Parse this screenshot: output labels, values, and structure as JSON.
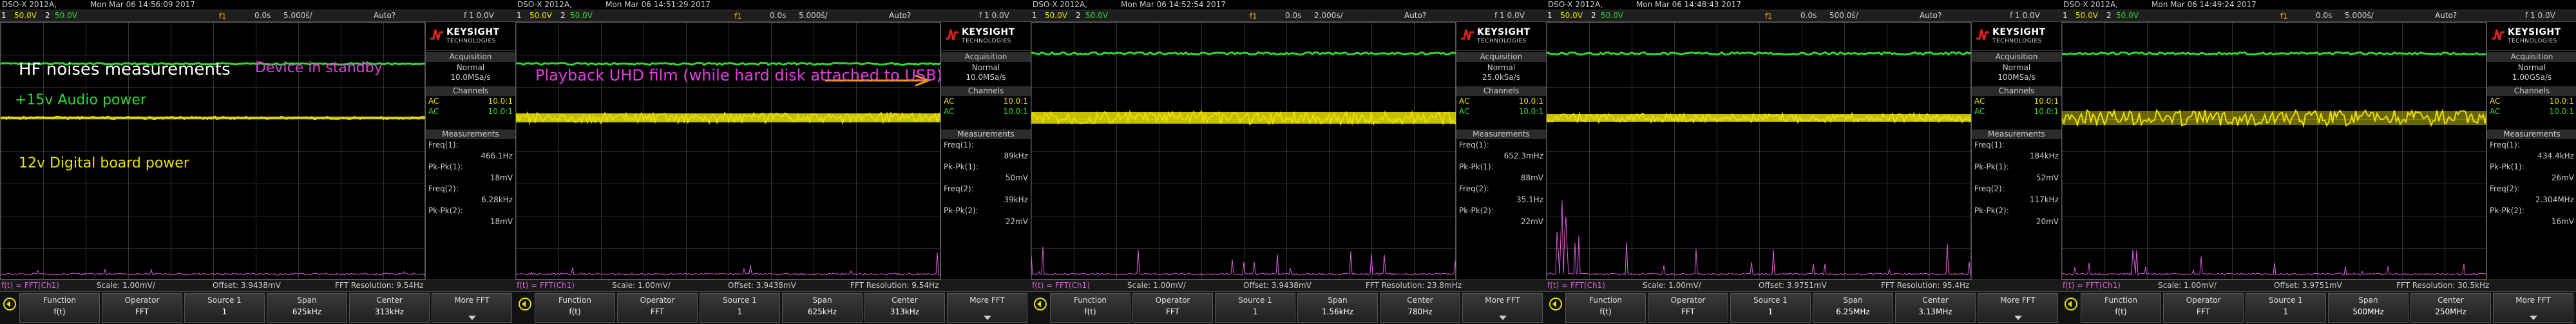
{
  "screens": [
    {
      "model": "DSO-X 2012A,",
      "datetime": "Mon Mar 06 14:56:09 2017",
      "status": {
        "ch1": "1",
        "ch1_scale": "50.0V",
        "ch2": "2",
        "ch2_scale": "50.0V",
        "trig": "f",
        "trig_level": "1",
        "offset": "0.0s",
        "timebase": "5.000ŝ/",
        "mode": "Auto?",
        "run": "f 1 0.0V"
      },
      "annotations": [
        {
          "text": "HF noises measurements",
          "color": "#ffffff"
        },
        {
          "text": "Device in standby",
          "color": "#e040e0"
        },
        {
          "text": "+15v Audio power",
          "color": "#2fd82f"
        },
        {
          "text": "12v Digital board power",
          "color": "#e8e000"
        }
      ],
      "panel": {
        "acq_mode": "Normal",
        "acq_rate": "10.0MSa/s",
        "channels": [
          {
            "coupling": "AC",
            "value": "10.0:1"
          },
          {
            "coupling": "AC",
            "value": "10.0:1"
          }
        ],
        "measurements": [
          {
            "label": "Freq(1):",
            "value": "466.1Hz"
          },
          {
            "label": "Pk-Pk(1):",
            "value": "18mV"
          },
          {
            "label": "Freq(2):",
            "value": "6.28kHz"
          },
          {
            "label": "Pk-Pk(2):",
            "value": "18mV"
          }
        ]
      },
      "fft": {
        "channel": "f(t) = FFT(Ch1)",
        "scale": "Scale: 1.00mV/",
        "offset": "Offset: 3.9438mV",
        "resolution": "FFT Resolution: 9.54Hz"
      },
      "softkeys": [
        {
          "l1": "Function",
          "l2": "f(t)"
        },
        {
          "l1": "Operator",
          "l2": "FFT"
        },
        {
          "l1": "Source 1",
          "l2": "1"
        },
        {
          "l1": "Span",
          "l2": "625kHz"
        },
        {
          "l1": "Center",
          "l2": "313kHz"
        },
        {
          "l1": "More FFT",
          "l2": ""
        }
      ],
      "traces": {
        "green_y": 0.16,
        "yellow_y": 0.37,
        "yellow_band": 0.01,
        "noise": 0.2
      }
    },
    {
      "model": "DSO-X 2012A,",
      "datetime": "Mon Mar 06 14:51:29 2017",
      "status": {
        "ch1": "1",
        "ch1_scale": "50.0V",
        "ch2": "2",
        "ch2_scale": "50.0V",
        "trig": "f",
        "trig_level": "1",
        "offset": "0.0s",
        "timebase": "5.000ŝ/",
        "mode": "Auto?",
        "run": "f 1 0.0V"
      },
      "annotations": [
        {
          "text": "Playback UHD film (while hard disk attached to USB)",
          "color": "#e040e0"
        }
      ],
      "panel": {
        "acq_mode": "Normal",
        "acq_rate": "10.0MSa/s",
        "channels": [
          {
            "coupling": "AC",
            "value": "10.0:1"
          },
          {
            "coupling": "AC",
            "value": "10.0:1"
          }
        ],
        "measurements": [
          {
            "label": "Freq(1):",
            "value": "89kHz"
          },
          {
            "label": "Pk-Pk(1):",
            "value": "50mV"
          },
          {
            "label": "Freq(2):",
            "value": "39kHz"
          },
          {
            "label": "Pk-Pk(2):",
            "value": "22mV"
          }
        ]
      },
      "fft": {
        "channel": "f(t) = FFT(Ch1)",
        "scale": "Scale: 1.00mV/",
        "offset": "Offset: 3.9438mV",
        "resolution": "FFT Resolution: 9.54Hz"
      },
      "softkeys": [
        {
          "l1": "Function",
          "l2": "f(t)"
        },
        {
          "l1": "Operator",
          "l2": "FFT"
        },
        {
          "l1": "Source 1",
          "l2": "1"
        },
        {
          "l1": "Span",
          "l2": "625kHz"
        },
        {
          "l1": "Center",
          "l2": "313kHz"
        },
        {
          "l1": "More FFT",
          "l2": ""
        }
      ],
      "traces": {
        "green_y": 0.16,
        "yellow_y": 0.37,
        "yellow_band": 0.035,
        "noise": 0.6
      }
    },
    {
      "model": "DSO-X 2012A,",
      "datetime": "Mon Mar 06 14:52:54 2017",
      "status": {
        "ch1": "1",
        "ch1_scale": "50.0V",
        "ch2": "2",
        "ch2_scale": "50.0V",
        "trig": "f",
        "trig_level": "1",
        "offset": "0.0s",
        "timebase": "2.000s/",
        "mode": "Auto?",
        "run": "f 1 0.0V"
      },
      "annotations": [],
      "panel": {
        "acq_mode": "Normal",
        "acq_rate": "25.0kSa/s",
        "channels": [
          {
            "coupling": "AC",
            "value": "10.0:1"
          },
          {
            "coupling": "AC",
            "value": "10.0:1"
          }
        ],
        "measurements": [
          {
            "label": "Freq(1):",
            "value": "652.3mHz"
          },
          {
            "label": "Pk-Pk(1):",
            "value": "88mV"
          },
          {
            "label": "Freq(2):",
            "value": "35.1Hz"
          },
          {
            "label": "Pk-Pk(2):",
            "value": "22mV"
          }
        ]
      },
      "fft": {
        "channel": "f(t) = FFT(Ch1)",
        "scale": "Scale: 1.00mV/",
        "offset": "Offset: 3.9438mV",
        "resolution": "FFT Resolution: 23.8mHz"
      },
      "softkeys": [
        {
          "l1": "Function",
          "l2": "f(t)"
        },
        {
          "l1": "Operator",
          "l2": "FFT"
        },
        {
          "l1": "Source 1",
          "l2": "1"
        },
        {
          "l1": "Span",
          "l2": "1.56kHz"
        },
        {
          "l1": "Center",
          "l2": "780Hz"
        },
        {
          "l1": "More FFT",
          "l2": ""
        }
      ],
      "traces": {
        "green_y": 0.12,
        "yellow_y": 0.37,
        "yellow_band": 0.045,
        "noise": 0.8
      }
    },
    {
      "model": "DSO-X 2012A,",
      "datetime": "Mon Mar 06 14:48:43 2017",
      "status": {
        "ch1": "1",
        "ch1_scale": "50.0V",
        "ch2": "2",
        "ch2_scale": "50.0V",
        "trig": "f",
        "trig_level": "1",
        "offset": "0.0s",
        "timebase": "500.0ŝ/",
        "mode": "Auto?",
        "run": "f 1 0.0V"
      },
      "annotations": [],
      "panel": {
        "acq_mode": "Normal",
        "acq_rate": "100MSa/s",
        "channels": [
          {
            "coupling": "AC",
            "value": "10.0:1"
          },
          {
            "coupling": "AC",
            "value": "10.0:1"
          }
        ],
        "measurements": [
          {
            "label": "Freq(1):",
            "value": "184kHz"
          },
          {
            "label": "Pk-Pk(1):",
            "value": "52mV"
          },
          {
            "label": "Freq(2):",
            "value": "117kHz"
          },
          {
            "label": "Pk-Pk(2):",
            "value": "20mV"
          }
        ]
      },
      "fft": {
        "channel": "f(t) = FFT(Ch1)",
        "scale": "Scale: 1.00mV/",
        "offset": "Offset: 3.9751mV",
        "resolution": "FFT Resolution: 95.4Hz"
      },
      "softkeys": [
        {
          "l1": "Function",
          "l2": "f(t)"
        },
        {
          "l1": "Operator",
          "l2": "FFT"
        },
        {
          "l1": "Source 1",
          "l2": "1"
        },
        {
          "l1": "Span",
          "l2": "6.25MHz"
        },
        {
          "l1": "Center",
          "l2": "3.13MHz"
        },
        {
          "l1": "More FFT",
          "l2": ""
        }
      ],
      "traces": {
        "green_y": 0.12,
        "yellow_y": 0.37,
        "yellow_band": 0.03,
        "noise": 0.9
      }
    },
    {
      "model": "DSO-X 2012A,",
      "datetime": "Mon Mar 06 14:49:24 2017",
      "status": {
        "ch1": "1",
        "ch1_scale": "50.0V",
        "ch2": "2",
        "ch2_scale": "50.0V",
        "trig": "f",
        "trig_level": "1",
        "offset": "0.0s",
        "timebase": "5.000ŝ/",
        "mode": "Auto?",
        "run": "f 1 0.0V"
      },
      "annotations": [],
      "panel": {
        "acq_mode": "Normal",
        "acq_rate": "1.00GSa/s",
        "channels": [
          {
            "coupling": "AC",
            "value": "10.0:1"
          },
          {
            "coupling": "AC",
            "value": "10.0:1"
          }
        ],
        "measurements": [
          {
            "label": "Freq(1):",
            "value": "434.4kHz"
          },
          {
            "label": "Pk-Pk(1):",
            "value": "26mV"
          },
          {
            "label": "Freq(2):",
            "value": "2.304MHz"
          },
          {
            "label": "Pk-Pk(2):",
            "value": "16mV"
          }
        ]
      },
      "fft": {
        "channel": "f(t) = FFT(Ch1)",
        "scale": "Scale: 1.00mV/",
        "offset": "Offset: 3.9751mV",
        "resolution": "FFT Resolution: 30.5kHz"
      },
      "softkeys": [
        {
          "l1": "Function",
          "l2": "f(t)"
        },
        {
          "l1": "Operator",
          "l2": "FFT"
        },
        {
          "l1": "Source 1",
          "l2": "1"
        },
        {
          "l1": "Span",
          "l2": "500MHz"
        },
        {
          "l1": "Center",
          "l2": "250MHz"
        },
        {
          "l1": "More FFT",
          "l2": ""
        }
      ],
      "traces": {
        "green_y": 0.12,
        "yellow_y": 0.37,
        "yellow_band": 0.055,
        "noise": 0.7
      }
    }
  ],
  "colors": {
    "ch1": "#e8e000",
    "ch2": "#2fd82f",
    "math": "#e060e0",
    "annotation_arrow": "#f0a000"
  },
  "logo": {
    "brand": "KEYSIGHT",
    "sub": "TECHNOLOGIES"
  },
  "panel_headers": {
    "acquisition": "Acquisition",
    "channels": "Channels",
    "measurements": "Measurements"
  }
}
